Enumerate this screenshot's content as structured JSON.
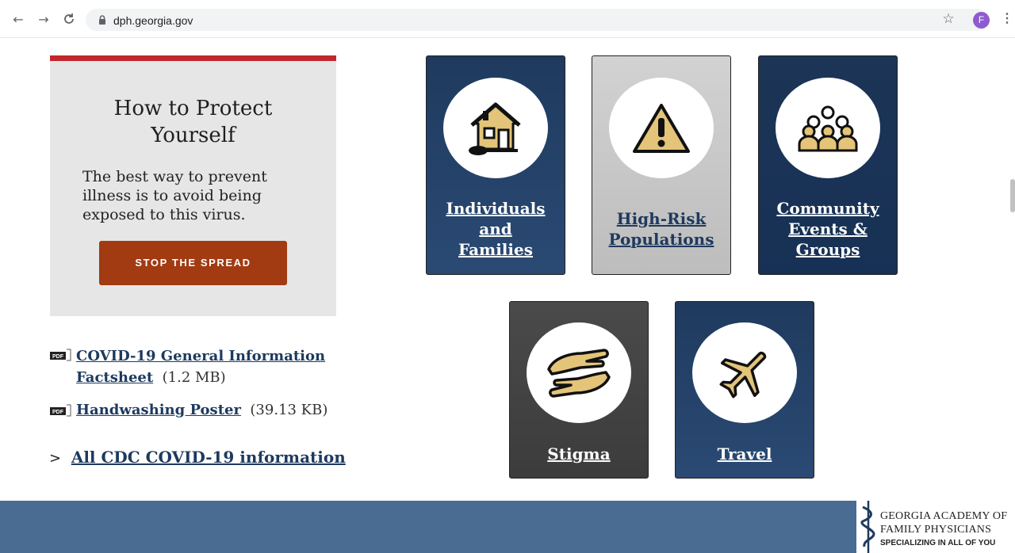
{
  "browser": {
    "back_icon": "←",
    "forward_icon": "→",
    "reload_icon": "C",
    "url": "dph.georgia.gov",
    "star_icon": "☆",
    "avatar_letter": "F",
    "menu_icon": "⋮"
  },
  "protect": {
    "title_line1": "How to Protect",
    "title_line2": "Yourself",
    "text": "The best way to prevent illness is to avoid being exposed to this virus.",
    "button": "STOP THE SPREAD"
  },
  "resources": [
    {
      "link_line1": "COVID-19 General Information",
      "link_line2": "Factsheet",
      "size": "(1.2 MB)"
    },
    {
      "link": "Handwashing Poster",
      "size": "(39.13 KB)"
    }
  ],
  "cdc": {
    "chevron": ">",
    "link": "All CDC COVID-19 information"
  },
  "tiles": [
    {
      "line1": "Individuals",
      "line2": "and",
      "line3": "Families",
      "icon": "house-icon"
    },
    {
      "line1": "High-Risk",
      "line2": "Populations",
      "icon": "warning-icon"
    },
    {
      "line1": "Community",
      "line2": "Events &",
      "line3": "Groups",
      "icon": "group-icon"
    },
    {
      "line1": "Stigma",
      "icon": "caring-hands-icon"
    },
    {
      "line1": "Travel",
      "icon": "airplane-icon"
    }
  ],
  "footer": {
    "logo_line1": "GEORGIA ACADEMY OF",
    "logo_line2": "FAMILY PHYSICIANS",
    "logo_line3": "SPECIALIZING IN ALL OF YOU"
  },
  "colors": {
    "accent_red": "#c2272d",
    "button_orange": "#a23a12",
    "navy": "#1f3a5e",
    "gold": "#e3c479",
    "footer_blue": "#4a6c93"
  }
}
